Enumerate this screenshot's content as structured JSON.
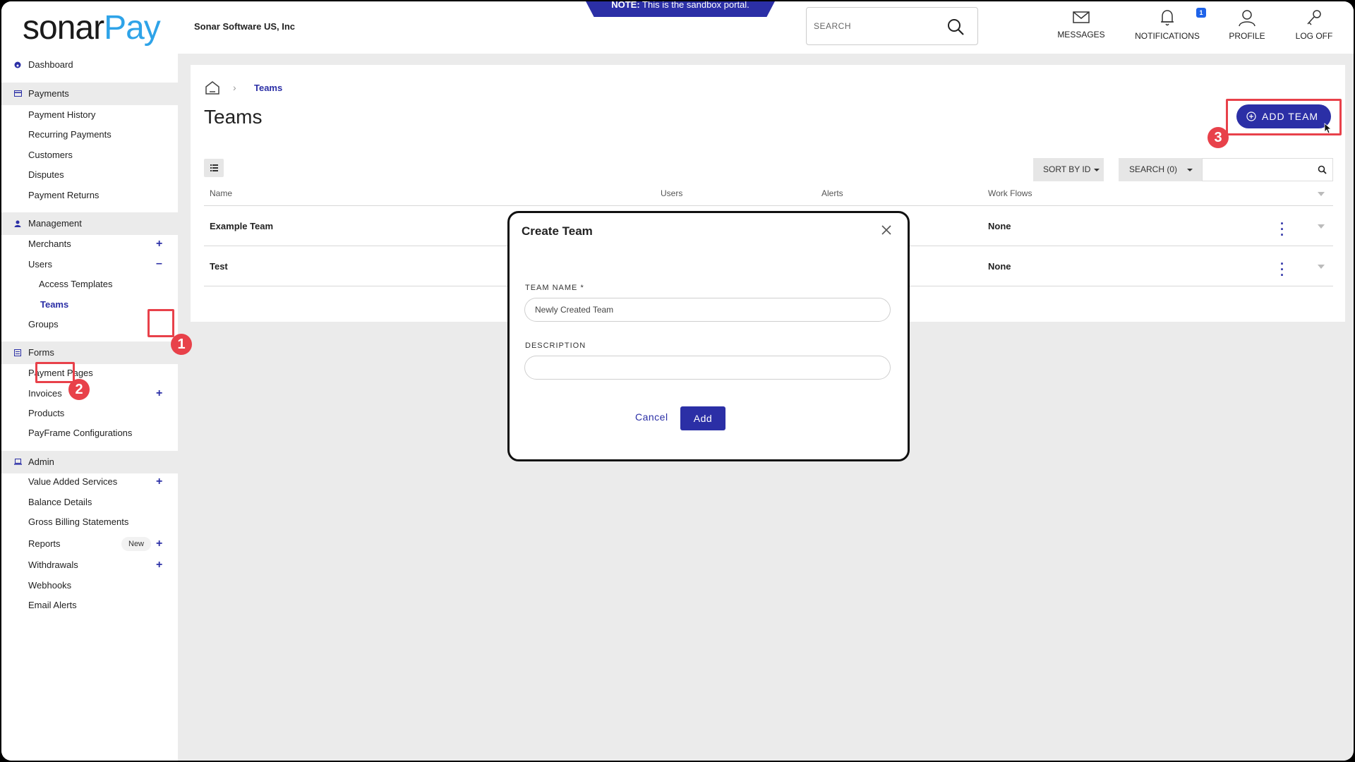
{
  "header": {
    "logo_part1": "sonar",
    "logo_part2": "Pay",
    "company": "Sonar Software US, Inc",
    "sandbox_note_bold": "NOTE:",
    "sandbox_note": " This is the sandbox portal.",
    "search_placeholder": "SEARCH",
    "nav": {
      "messages": "MESSAGES",
      "notifications": "NOTIFICATIONS",
      "notifications_count": "1",
      "profile": "PROFILE",
      "logoff": "LOG OFF"
    }
  },
  "sidebar": {
    "dashboard": "Dashboard",
    "payments": "Payments",
    "payment_history": "Payment History",
    "recurring_payments": "Recurring Payments",
    "customers": "Customers",
    "disputes": "Disputes",
    "payment_returns": "Payment Returns",
    "management": "Management",
    "merchants": "Merchants",
    "users": "Users",
    "access_templates": "Access Templates",
    "teams": "Teams",
    "groups": "Groups",
    "forms": "Forms",
    "payment_pages": "Payment Pages",
    "invoices": "Invoices",
    "products": "Products",
    "payframe": "PayFrame Configurations",
    "admin": "Admin",
    "value_added": "Value Added Services",
    "balance_details": "Balance Details",
    "gross_billing": "Gross Billing Statements",
    "reports": "Reports",
    "reports_badge": "New",
    "withdrawals": "Withdrawals",
    "webhooks": "Webhooks",
    "email_alerts": "Email Alerts"
  },
  "main": {
    "breadcrumb_current": "Teams",
    "title": "Teams",
    "add_team": "ADD TEAM",
    "sort_by": "SORT BY ID",
    "search_filter": "SEARCH (0)",
    "columns": {
      "name": "Name",
      "users": "Users",
      "alerts": "Alerts",
      "workflows": "Work Flows"
    },
    "rows": [
      {
        "name": "Example Team",
        "workflows": "None"
      },
      {
        "name": "Test",
        "workflows": "None"
      }
    ]
  },
  "annotations": {
    "n1": "1",
    "n2": "2",
    "n3": "3"
  },
  "modal": {
    "title": "Create Team",
    "team_name_label": "TEAM NAME *",
    "team_name_value": "Newly Created Team",
    "description_label": "DESCRIPTION",
    "description_value": "",
    "cancel": "Cancel",
    "add": "Add"
  }
}
